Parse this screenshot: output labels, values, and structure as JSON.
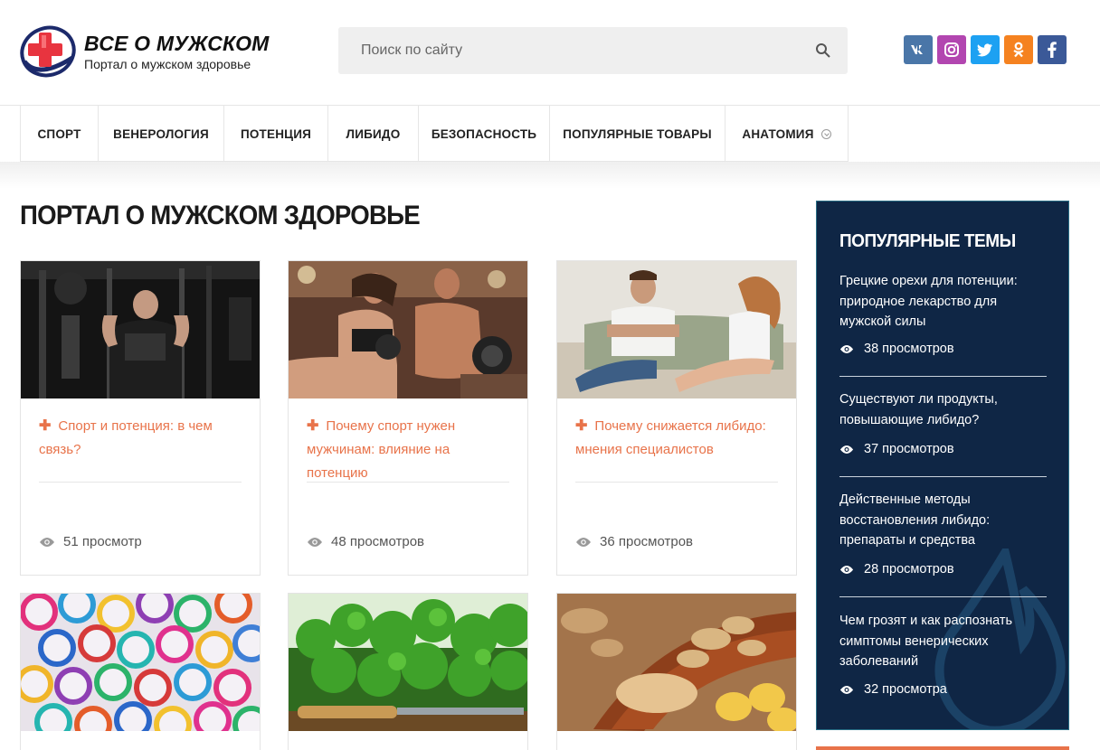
{
  "header": {
    "logo_title": "ВСЕ О МУЖСКОМ",
    "logo_subtitle": "Портал о мужском здоровье",
    "search_placeholder": "Поиск по сайту",
    "social": [
      {
        "name": "vk",
        "label": "vk",
        "color": "#4a76a8"
      },
      {
        "name": "instagram",
        "label": "instagram",
        "color": "#b246b0"
      },
      {
        "name": "twitter",
        "label": "twitter",
        "color": "#1da1f2"
      },
      {
        "name": "odnoklassniki",
        "label": "ok",
        "color": "#f58220"
      },
      {
        "name": "facebook",
        "label": "f",
        "color": "#3b5998"
      }
    ]
  },
  "nav": {
    "items": [
      "СПОРТ",
      "ВЕНЕРОЛОГИЯ",
      "ПОТЕНЦИЯ",
      "ЛИБИДО",
      "БЕЗОПАСНОСТЬ",
      "ПОПУЛЯРНЫЕ ТОВАРЫ",
      "АНАТОМИЯ"
    ]
  },
  "main": {
    "title": "ПОРТАЛ О МУЖСКОМ ЗДОРОВЬЕ",
    "cards": [
      {
        "title": "Спорт и потенция: в чем связь?",
        "views": "51 просмотр",
        "image": "gym-man-photo"
      },
      {
        "title": "Почему спорт нужен мужчинам: влияние на потенцию",
        "views": "48 просмотров",
        "image": "fitness-couple-photo"
      },
      {
        "title": "Почему снижается либидо: мнения специалистов",
        "views": "36 просмотров",
        "image": "couple-sofa-photo"
      },
      {
        "title": "",
        "views": "",
        "image": "condoms-photo"
      },
      {
        "title": "",
        "views": "",
        "image": "parsley-photo"
      },
      {
        "title": "",
        "views": "",
        "image": "ginger-photo"
      }
    ]
  },
  "sidebar": {
    "title": "ПОПУЛЯРНЫЕ ТЕМЫ",
    "items": [
      {
        "title": "Грецкие орехи для потенции: природное лекарство для мужской силы",
        "views": "38 просмотров"
      },
      {
        "title": "Существуют ли продукты, повышающие либидо?",
        "views": "37 просмотров"
      },
      {
        "title": "Действенные методы восстановления либидо: препараты и средства",
        "views": "28 просмотров"
      },
      {
        "title": "Чем грозят и как распознать симптомы венерических заболеваний",
        "views": "32 просмотра"
      }
    ]
  },
  "colors": {
    "accent": "#e8734a",
    "sidebar_bg": "#0f2645",
    "logo_red": "#e8343f",
    "logo_navy": "#1c2a6b"
  }
}
